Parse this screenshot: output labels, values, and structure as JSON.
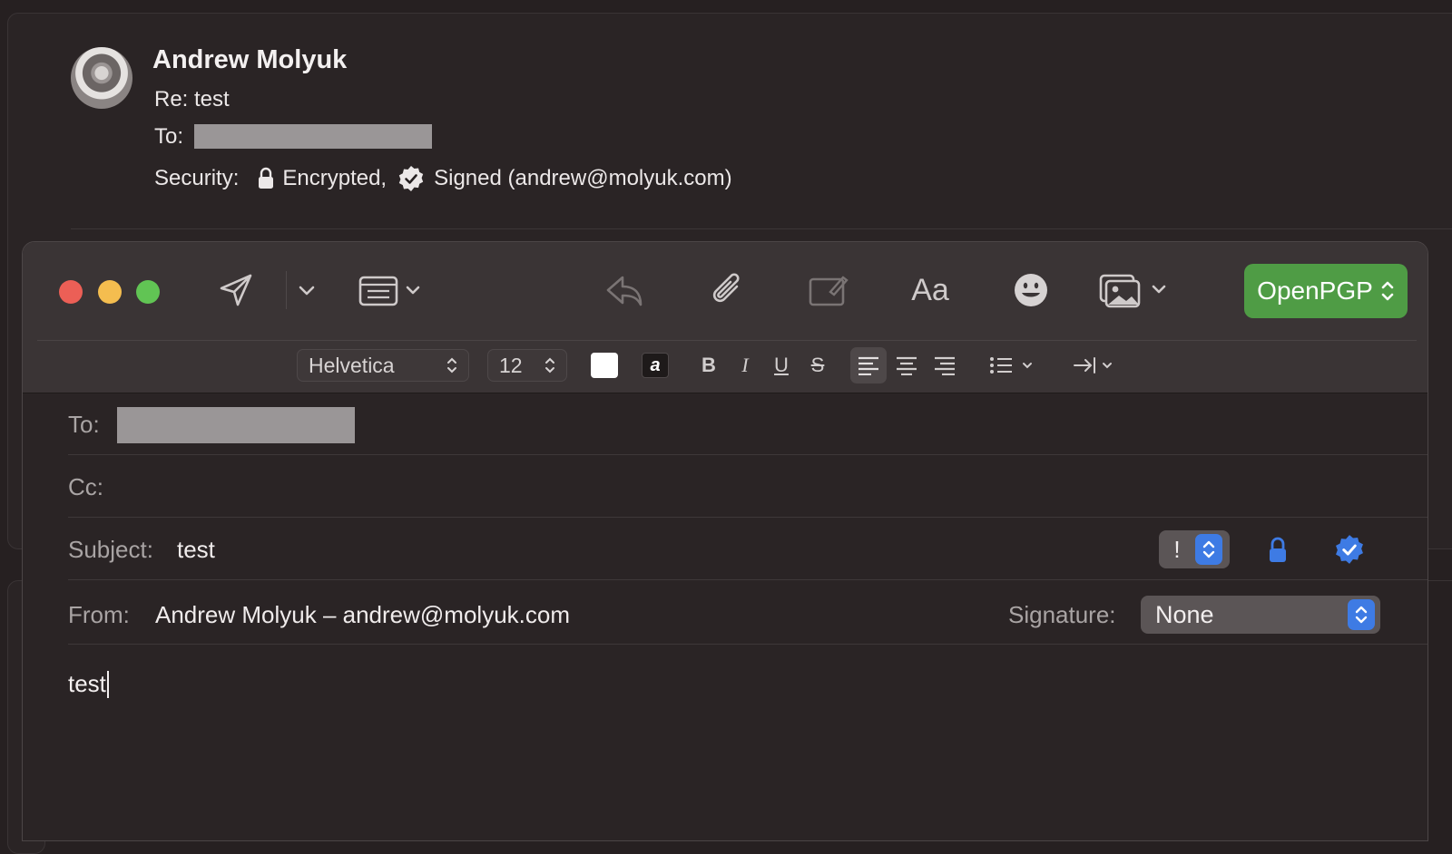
{
  "message": {
    "sender_name": "Andrew Molyuk",
    "subject": "Re: test",
    "to_label": "To:",
    "security_label": "Security:",
    "encrypted_label": "Encrypted,",
    "signed_label": "Signed (andrew@molyuk.com)"
  },
  "compose": {
    "toolbar": {
      "openpgp_label": "OpenPGP",
      "icons": [
        "send-icon",
        "chevron-down-icon",
        "header-fields-icon",
        "reply-icon",
        "paperclip-icon",
        "markup-icon",
        "fonts-icon",
        "emoji-icon",
        "photo-browser-icon"
      ]
    },
    "format_bar": {
      "font": "Helvetica",
      "size": "12",
      "bold": "B",
      "italic": "I",
      "underline": "U",
      "strike": "S",
      "text_color_swatch": "#ffffff",
      "highlight_glyph": "a"
    },
    "headers": {
      "to_label": "To:",
      "cc_label": "Cc:",
      "subject_label": "Subject:",
      "subject_value": "test",
      "priority_glyph": "!",
      "from_label": "From:",
      "from_value": "Andrew Molyuk – andrew@molyuk.com",
      "signature_label": "Signature:",
      "signature_value": "None"
    },
    "body": "test"
  },
  "colors": {
    "background": "#262021",
    "toolbar": "#3a3435",
    "openpgp_green": "#4f9c45",
    "accent_blue": "#3e7be4",
    "close": "#ec5f56",
    "minimize": "#f4bd4f",
    "zoom": "#61c454"
  }
}
